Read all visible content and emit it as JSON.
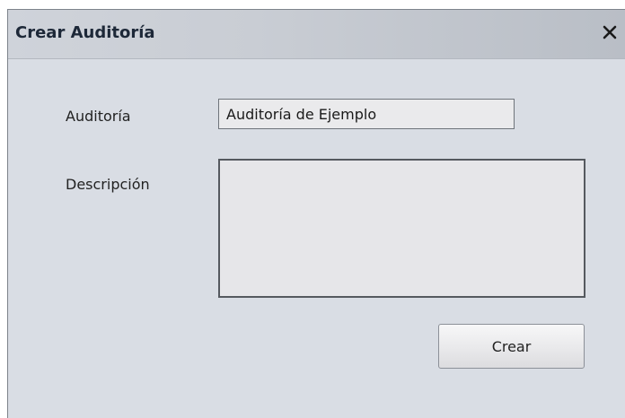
{
  "window": {
    "title": "Crear Auditoría",
    "close_icon": "close-icon"
  },
  "form": {
    "auditoria_label": "Auditoría",
    "auditoria_value": "Auditoría de Ejemplo",
    "descripcion_label": "Descripción",
    "descripcion_value": ""
  },
  "actions": {
    "crear_label": "Crear"
  }
}
